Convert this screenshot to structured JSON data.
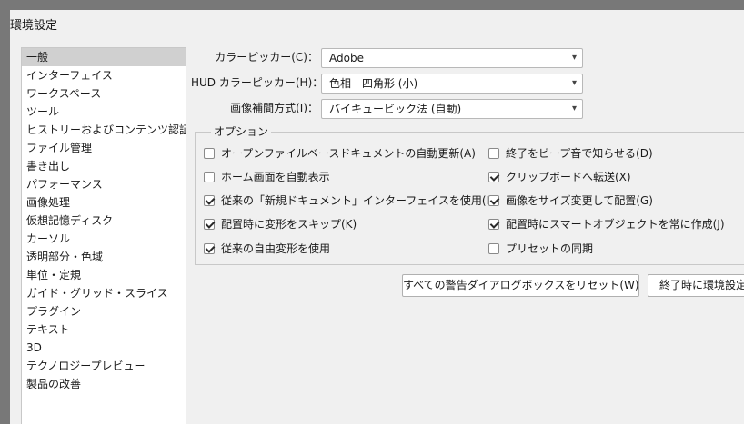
{
  "window": {
    "title": "環境設定"
  },
  "sidebar": {
    "items": [
      {
        "label": "一般",
        "selected": true
      },
      {
        "label": "インターフェイス"
      },
      {
        "label": "ワークスペース"
      },
      {
        "label": "ツール"
      },
      {
        "label": "ヒストリーおよびコンテンツ認証情報"
      },
      {
        "label": "ファイル管理"
      },
      {
        "label": "書き出し"
      },
      {
        "label": "パフォーマンス"
      },
      {
        "label": "画像処理"
      },
      {
        "label": "仮想記憶ディスク"
      },
      {
        "label": "カーソル"
      },
      {
        "label": "透明部分・色域"
      },
      {
        "label": "単位・定規"
      },
      {
        "label": "ガイド・グリッド・スライス"
      },
      {
        "label": "プラグイン"
      },
      {
        "label": "テキスト"
      },
      {
        "label": "3D"
      },
      {
        "label": "テクノロジープレビュー"
      },
      {
        "label": "製品の改善"
      }
    ]
  },
  "fields": {
    "color_picker": {
      "label": "カラーピッカー(C)：",
      "value": "Adobe"
    },
    "hud_color_picker": {
      "label": "HUD カラーピッカー(H)：",
      "value": "色相 - 四角形 (小)"
    },
    "interpolation": {
      "label": "画像補間方式(I)：",
      "value": "バイキュービック法 (自動)"
    }
  },
  "options": {
    "title": "オプション",
    "left": [
      {
        "label": "オープンファイルベースドキュメントの自動更新(A)",
        "checked": false
      },
      {
        "label": "ホーム画面を自動表示",
        "checked": false
      },
      {
        "label": "従来の「新規ドキュメント」インターフェイスを使用(L)",
        "checked": true
      },
      {
        "label": "配置時に変形をスキップ(K)",
        "checked": true
      },
      {
        "label": "従来の自由変形を使用",
        "checked": true
      }
    ],
    "right": [
      {
        "label": "終了をビープ音で知らせる(D)",
        "checked": false
      },
      {
        "label": "クリップボードへ転送(X)",
        "checked": true
      },
      {
        "label": "画像をサイズ変更して配置(G)",
        "checked": true
      },
      {
        "label": "配置時にスマートオブジェクトを常に作成(J)",
        "checked": true
      },
      {
        "label": "プリセットの同期",
        "checked": false
      }
    ]
  },
  "buttons": {
    "reset_warnings": "すべての警告ダイアログボックスをリセット(W)",
    "reset_on_quit": "終了時に環境設定"
  },
  "icons": {
    "dropdown": "chevron-down-icon",
    "checkbox": "checkbox-icon"
  }
}
